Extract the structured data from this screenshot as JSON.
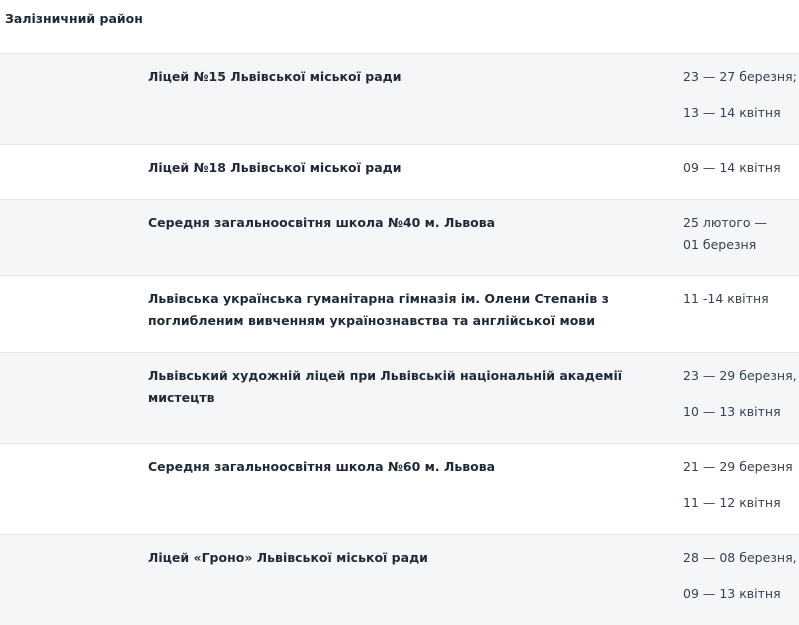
{
  "district": {
    "title": "Залізничний район"
  },
  "rows": [
    {
      "school": "Ліцей №15 Львівської міської ради",
      "dates": [
        "23 — 27 березня;",
        "13 — 14 квітня"
      ]
    },
    {
      "school": "Ліцей №18 Львівської міської ради",
      "dates": [
        "09 — 14 квітня"
      ]
    },
    {
      "school": "Середня загальноосвітня школа №40 м. Львова",
      "dates": [
        "25 лютого —",
        "01 березня"
      ]
    },
    {
      "school": "Львівська українська гуманітарна гімназія ім. Олени Степанів з поглибленим вивченням українознавства та англійської мови",
      "dates": [
        "11 -14 квітня"
      ]
    },
    {
      "school": "Львівський художній ліцей при Львівській національній академії мистецтв",
      "dates": [
        "23 — 29 березня,",
        "10 — 13 квітня"
      ]
    },
    {
      "school": "Середня загальноосвітня школа №60 м. Львова",
      "dates": [
        "21 — 29 березня",
        "11 — 12 квітня"
      ]
    },
    {
      "school": "Ліцей «Гроно» Львівської міської ради",
      "dates": [
        "28 — 08 березня,",
        "09 — 13 квітня"
      ]
    }
  ]
}
